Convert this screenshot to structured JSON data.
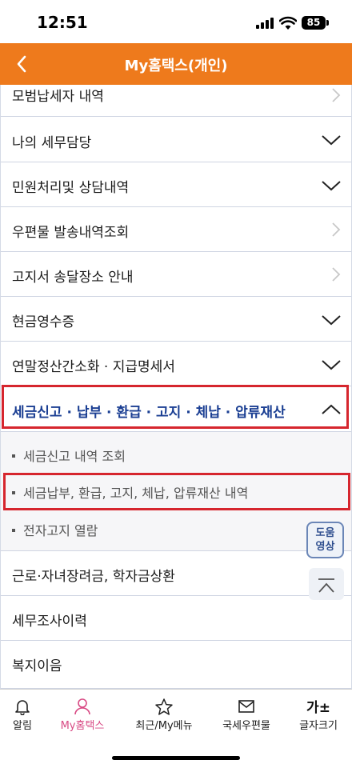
{
  "status": {
    "time": "12:51",
    "battery": "85"
  },
  "header": {
    "title": "My홈택스(개인)"
  },
  "menu": [
    {
      "label": "모범납세자 내역",
      "icon": "chevron-right-icon"
    },
    {
      "label": "나의 세무담당",
      "icon": "chevron-down-icon"
    },
    {
      "label": "민원처리및 상담내역",
      "icon": "chevron-down-icon"
    },
    {
      "label": "우편물 발송내역조회",
      "icon": "chevron-right-icon"
    },
    {
      "label": "고지서 송달장소 안내",
      "icon": "chevron-right-icon"
    },
    {
      "label": "현금영수증",
      "icon": "chevron-down-icon"
    },
    {
      "label": "연말정산간소화 · 지급명세서",
      "icon": "chevron-down-icon"
    },
    {
      "label": "세금신고 · 납부 · 환급 · 고지 · 체납 · 압류재산",
      "icon": "chevron-up-icon",
      "expanded": true
    },
    {
      "label": "근로·자녀장려금, 학자금상환",
      "icon": "chevron-down-icon"
    },
    {
      "label": "세무조사이력",
      "icon": "none"
    },
    {
      "label": "복지이음",
      "icon": "none"
    }
  ],
  "submenu": [
    {
      "label": "세금신고 내역 조회"
    },
    {
      "label": "세금납부, 환급, 고지, 체납, 압류재산 내역"
    },
    {
      "label": "전자고지 열람"
    }
  ],
  "help_button": {
    "line1": "도움",
    "line2": "영상"
  },
  "tabs": [
    {
      "label": "알림",
      "icon": "bell-icon"
    },
    {
      "label": "My홈택스",
      "icon": "person-icon",
      "active": true
    },
    {
      "label": "최근/My메뉴",
      "icon": "star-icon"
    },
    {
      "label": "국세우편물",
      "icon": "mail-icon"
    },
    {
      "label": "글자크기",
      "icon": "text-size-icon"
    }
  ],
  "tab_text_icon": "가±",
  "colors": {
    "accent": "#ee7a1c",
    "active_text": "#1b3f93",
    "highlight_box": "#d6262e",
    "tab_active": "#d84a84"
  }
}
